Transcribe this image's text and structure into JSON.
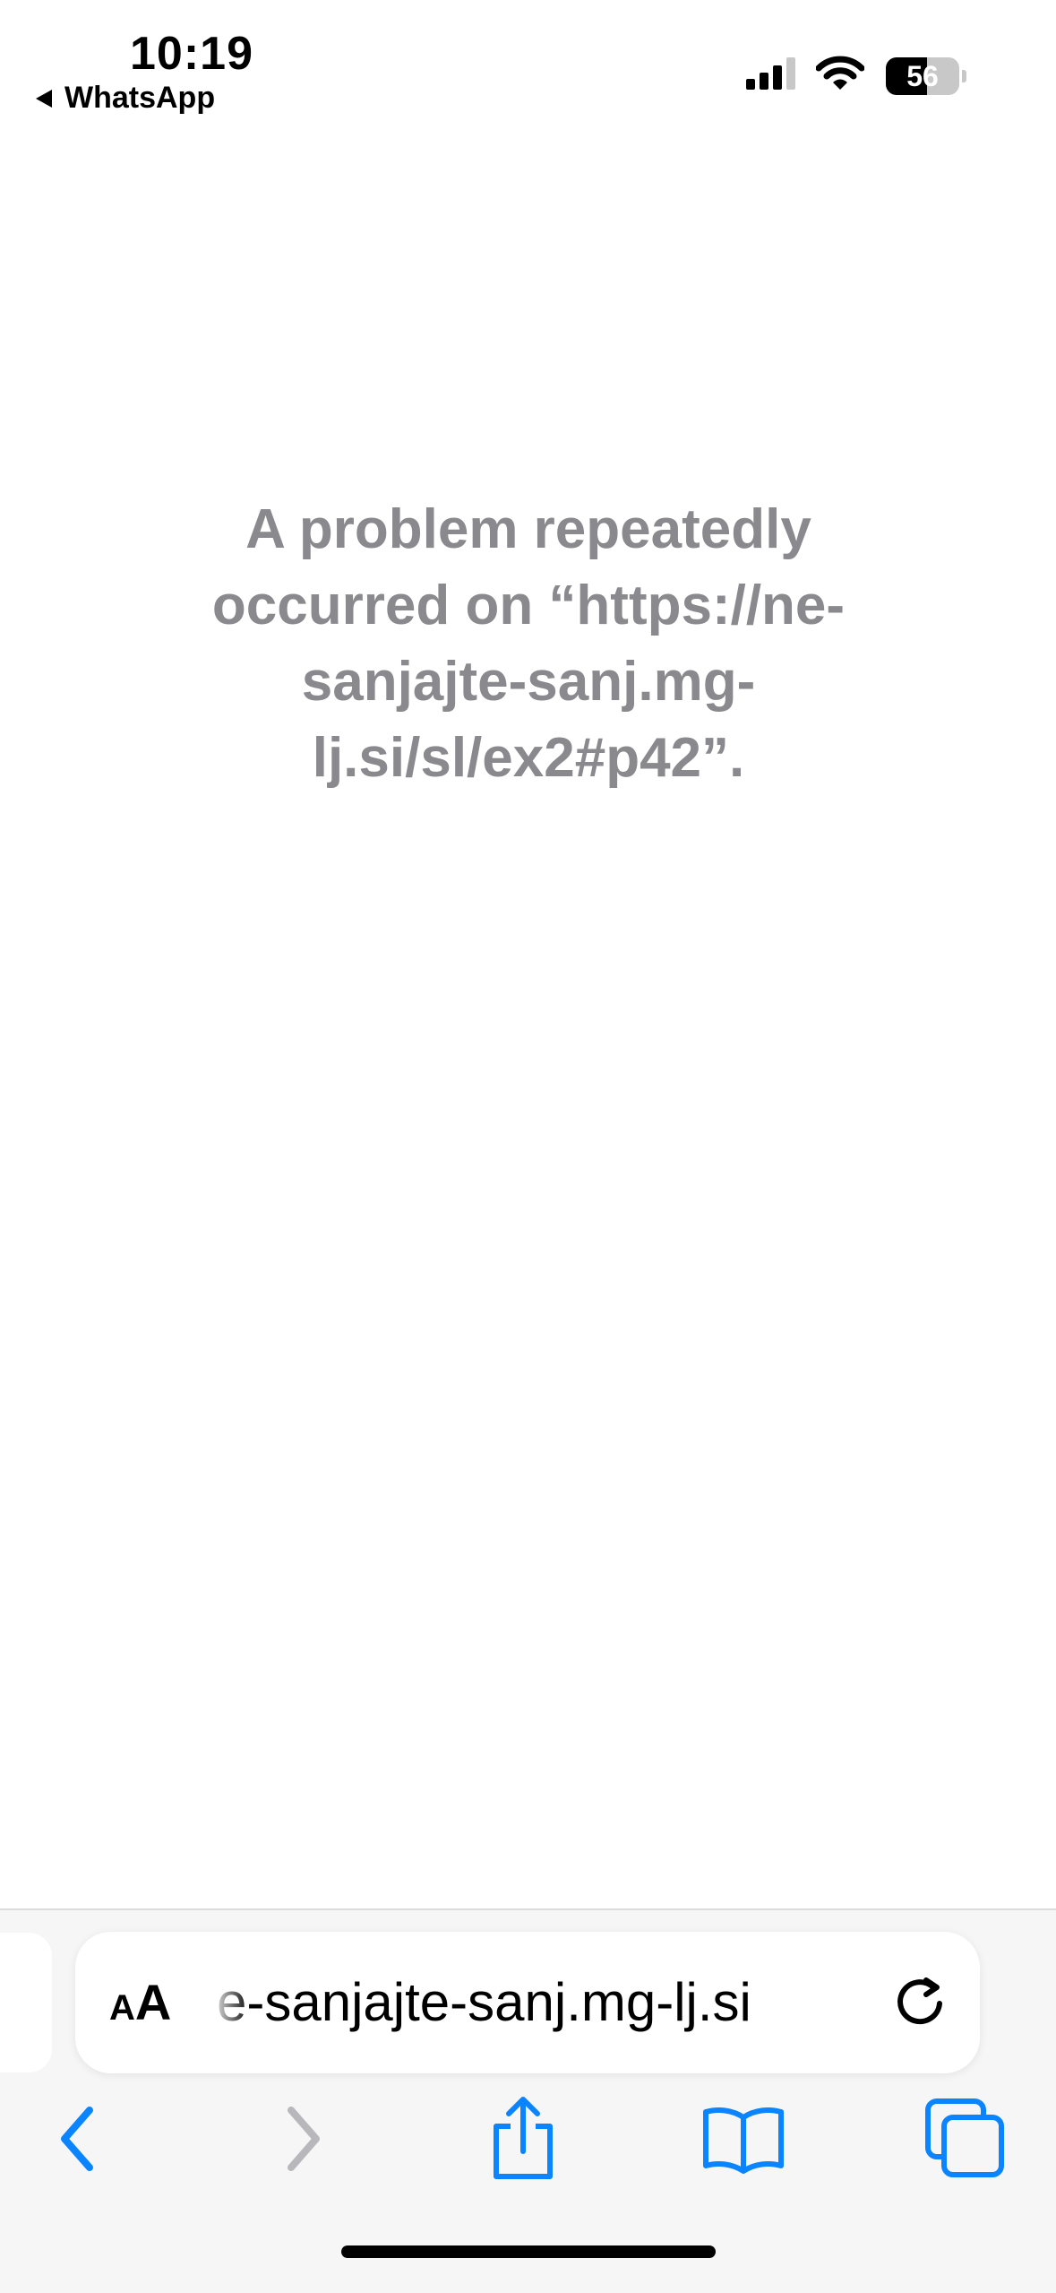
{
  "status_bar": {
    "time": "10:19",
    "back_app": "WhatsApp",
    "battery_level": "56",
    "battery_fraction": 0.56
  },
  "page": {
    "error_message": "A problem repeatedly occurred on “https://ne-sanjajte-sanj.mg-lj.si/sl/ex2#p42”."
  },
  "address_bar": {
    "text_size_small": "A",
    "text_size_big": "A",
    "url_display": "e-sanjajte-sanj.mg-lj.si"
  },
  "toolbar": {
    "icons": [
      "back-icon",
      "forward-icon",
      "share-icon",
      "bookmarks-icon",
      "tabs-icon"
    ]
  },
  "colors": {
    "accent": "#0a84ff",
    "disabled": "#b8b8bc",
    "error_text": "#8a8a8e"
  }
}
